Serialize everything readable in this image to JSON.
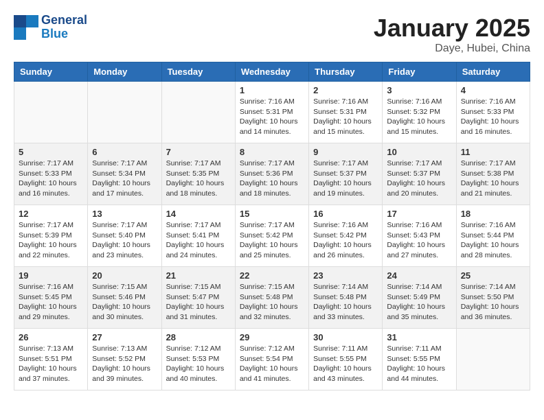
{
  "logo": {
    "text1": "General",
    "text2": "Blue"
  },
  "title": "January 2025",
  "location": "Daye, Hubei, China",
  "days_of_week": [
    "Sunday",
    "Monday",
    "Tuesday",
    "Wednesday",
    "Thursday",
    "Friday",
    "Saturday"
  ],
  "weeks": [
    [
      {
        "day": "",
        "info": ""
      },
      {
        "day": "",
        "info": ""
      },
      {
        "day": "",
        "info": ""
      },
      {
        "day": "1",
        "info": "Sunrise: 7:16 AM\nSunset: 5:31 PM\nDaylight: 10 hours\nand 14 minutes."
      },
      {
        "day": "2",
        "info": "Sunrise: 7:16 AM\nSunset: 5:31 PM\nDaylight: 10 hours\nand 15 minutes."
      },
      {
        "day": "3",
        "info": "Sunrise: 7:16 AM\nSunset: 5:32 PM\nDaylight: 10 hours\nand 15 minutes."
      },
      {
        "day": "4",
        "info": "Sunrise: 7:16 AM\nSunset: 5:33 PM\nDaylight: 10 hours\nand 16 minutes."
      }
    ],
    [
      {
        "day": "5",
        "info": "Sunrise: 7:17 AM\nSunset: 5:33 PM\nDaylight: 10 hours\nand 16 minutes."
      },
      {
        "day": "6",
        "info": "Sunrise: 7:17 AM\nSunset: 5:34 PM\nDaylight: 10 hours\nand 17 minutes."
      },
      {
        "day": "7",
        "info": "Sunrise: 7:17 AM\nSunset: 5:35 PM\nDaylight: 10 hours\nand 18 minutes."
      },
      {
        "day": "8",
        "info": "Sunrise: 7:17 AM\nSunset: 5:36 PM\nDaylight: 10 hours\nand 18 minutes."
      },
      {
        "day": "9",
        "info": "Sunrise: 7:17 AM\nSunset: 5:37 PM\nDaylight: 10 hours\nand 19 minutes."
      },
      {
        "day": "10",
        "info": "Sunrise: 7:17 AM\nSunset: 5:37 PM\nDaylight: 10 hours\nand 20 minutes."
      },
      {
        "day": "11",
        "info": "Sunrise: 7:17 AM\nSunset: 5:38 PM\nDaylight: 10 hours\nand 21 minutes."
      }
    ],
    [
      {
        "day": "12",
        "info": "Sunrise: 7:17 AM\nSunset: 5:39 PM\nDaylight: 10 hours\nand 22 minutes."
      },
      {
        "day": "13",
        "info": "Sunrise: 7:17 AM\nSunset: 5:40 PM\nDaylight: 10 hours\nand 23 minutes."
      },
      {
        "day": "14",
        "info": "Sunrise: 7:17 AM\nSunset: 5:41 PM\nDaylight: 10 hours\nand 24 minutes."
      },
      {
        "day": "15",
        "info": "Sunrise: 7:17 AM\nSunset: 5:42 PM\nDaylight: 10 hours\nand 25 minutes."
      },
      {
        "day": "16",
        "info": "Sunrise: 7:16 AM\nSunset: 5:42 PM\nDaylight: 10 hours\nand 26 minutes."
      },
      {
        "day": "17",
        "info": "Sunrise: 7:16 AM\nSunset: 5:43 PM\nDaylight: 10 hours\nand 27 minutes."
      },
      {
        "day": "18",
        "info": "Sunrise: 7:16 AM\nSunset: 5:44 PM\nDaylight: 10 hours\nand 28 minutes."
      }
    ],
    [
      {
        "day": "19",
        "info": "Sunrise: 7:16 AM\nSunset: 5:45 PM\nDaylight: 10 hours\nand 29 minutes."
      },
      {
        "day": "20",
        "info": "Sunrise: 7:15 AM\nSunset: 5:46 PM\nDaylight: 10 hours\nand 30 minutes."
      },
      {
        "day": "21",
        "info": "Sunrise: 7:15 AM\nSunset: 5:47 PM\nDaylight: 10 hours\nand 31 minutes."
      },
      {
        "day": "22",
        "info": "Sunrise: 7:15 AM\nSunset: 5:48 PM\nDaylight: 10 hours\nand 32 minutes."
      },
      {
        "day": "23",
        "info": "Sunrise: 7:14 AM\nSunset: 5:48 PM\nDaylight: 10 hours\nand 33 minutes."
      },
      {
        "day": "24",
        "info": "Sunrise: 7:14 AM\nSunset: 5:49 PM\nDaylight: 10 hours\nand 35 minutes."
      },
      {
        "day": "25",
        "info": "Sunrise: 7:14 AM\nSunset: 5:50 PM\nDaylight: 10 hours\nand 36 minutes."
      }
    ],
    [
      {
        "day": "26",
        "info": "Sunrise: 7:13 AM\nSunset: 5:51 PM\nDaylight: 10 hours\nand 37 minutes."
      },
      {
        "day": "27",
        "info": "Sunrise: 7:13 AM\nSunset: 5:52 PM\nDaylight: 10 hours\nand 39 minutes."
      },
      {
        "day": "28",
        "info": "Sunrise: 7:12 AM\nSunset: 5:53 PM\nDaylight: 10 hours\nand 40 minutes."
      },
      {
        "day": "29",
        "info": "Sunrise: 7:12 AM\nSunset: 5:54 PM\nDaylight: 10 hours\nand 41 minutes."
      },
      {
        "day": "30",
        "info": "Sunrise: 7:11 AM\nSunset: 5:55 PM\nDaylight: 10 hours\nand 43 minutes."
      },
      {
        "day": "31",
        "info": "Sunrise: 7:11 AM\nSunset: 5:55 PM\nDaylight: 10 hours\nand 44 minutes."
      },
      {
        "day": "",
        "info": ""
      }
    ]
  ]
}
